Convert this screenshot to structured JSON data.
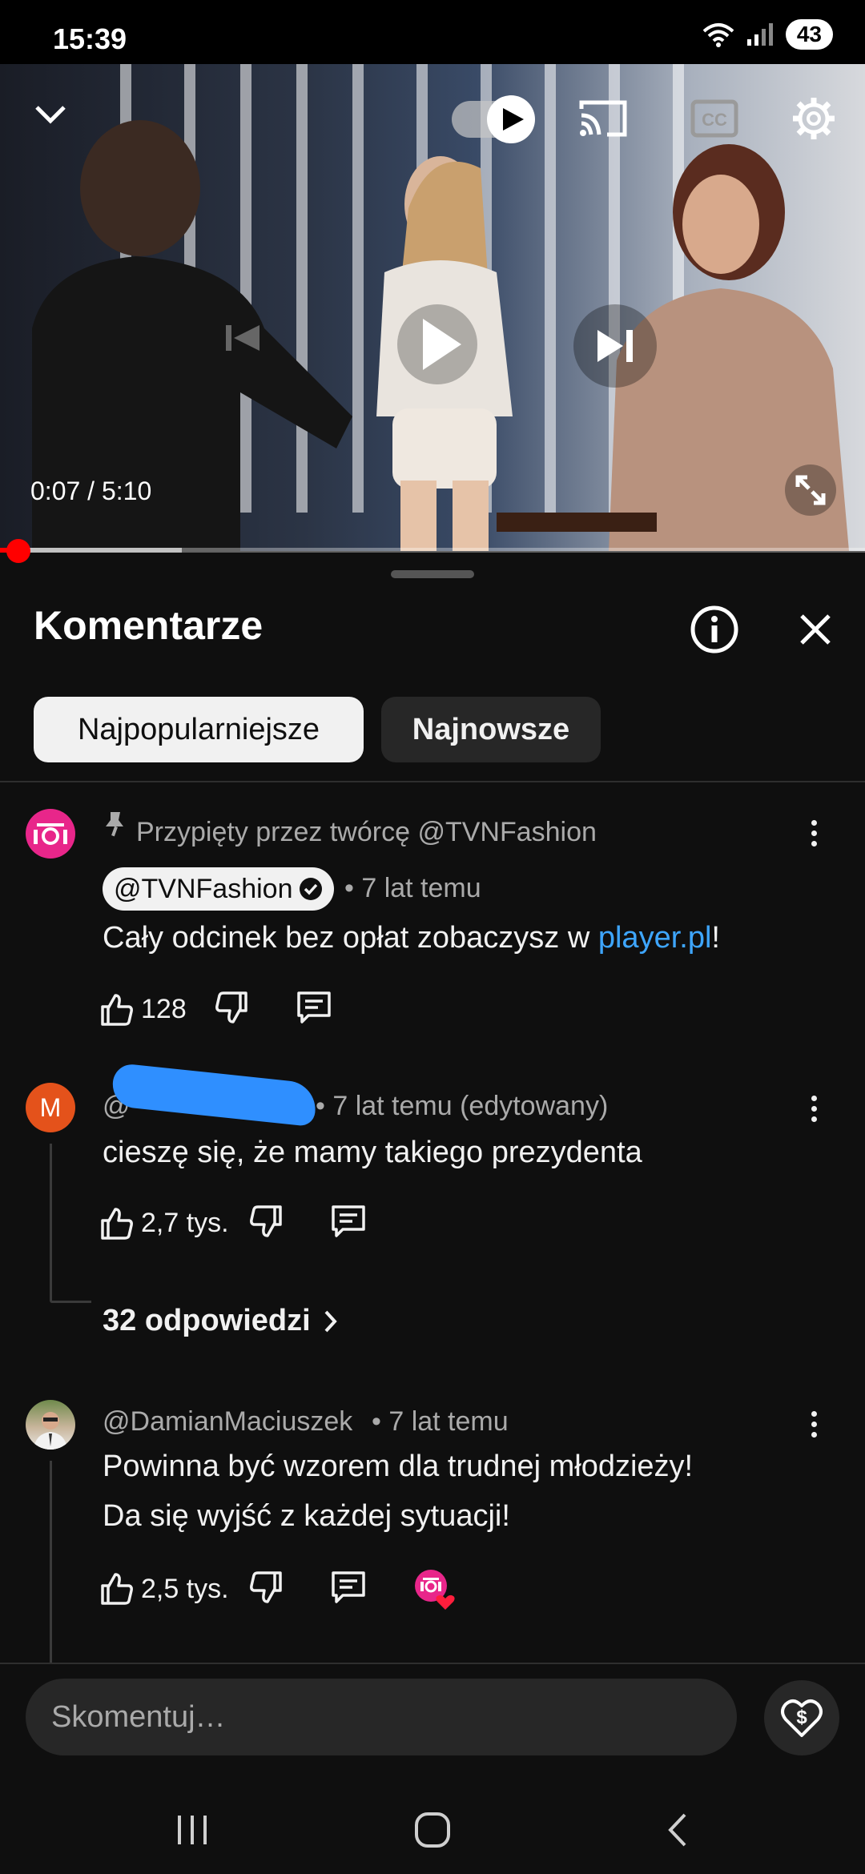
{
  "status_bar": {
    "time": "15:39",
    "battery": "43"
  },
  "video": {
    "current_time": "0:07",
    "separator": " / ",
    "duration": "5:10",
    "progress": 0.022,
    "buffered": 0.21
  },
  "comments_sheet": {
    "title": "Komentarze",
    "sort_chips": [
      "Najpopularniejsze",
      "Najnowsze"
    ]
  },
  "comments": [
    {
      "pinned_label": "Przypięty przez twórcę @TVNFashion",
      "author": "@TVNFashion",
      "time": "• 7 lat temu",
      "text_prefix": "Cały odcinek bez opłat zobaczysz w ",
      "text_link": "player.pl",
      "text_suffix": "!",
      "likes": "128"
    },
    {
      "avatar_letter": "M",
      "author_visible": "@",
      "time": "• 7 lat temu (edytowany)",
      "text": "cieszę się, że mamy takiego prezydenta",
      "likes": "2,7 tys.",
      "replies": "32 odpowiedzi"
    },
    {
      "author": "@DamianMaciuszek",
      "time": "• 7 lat temu",
      "text_line1": "Powinna być wzorem dla trudnej młodzieży!",
      "text_line2": "Da się wyjść z każdej sytuacji!",
      "likes": "2,5 tys."
    }
  ],
  "input": {
    "placeholder": "Skomentuj…"
  },
  "colors": {
    "accent_red": "#ff0000",
    "link_blue": "#3ea6ff",
    "brand_pink": "#e8268a"
  }
}
